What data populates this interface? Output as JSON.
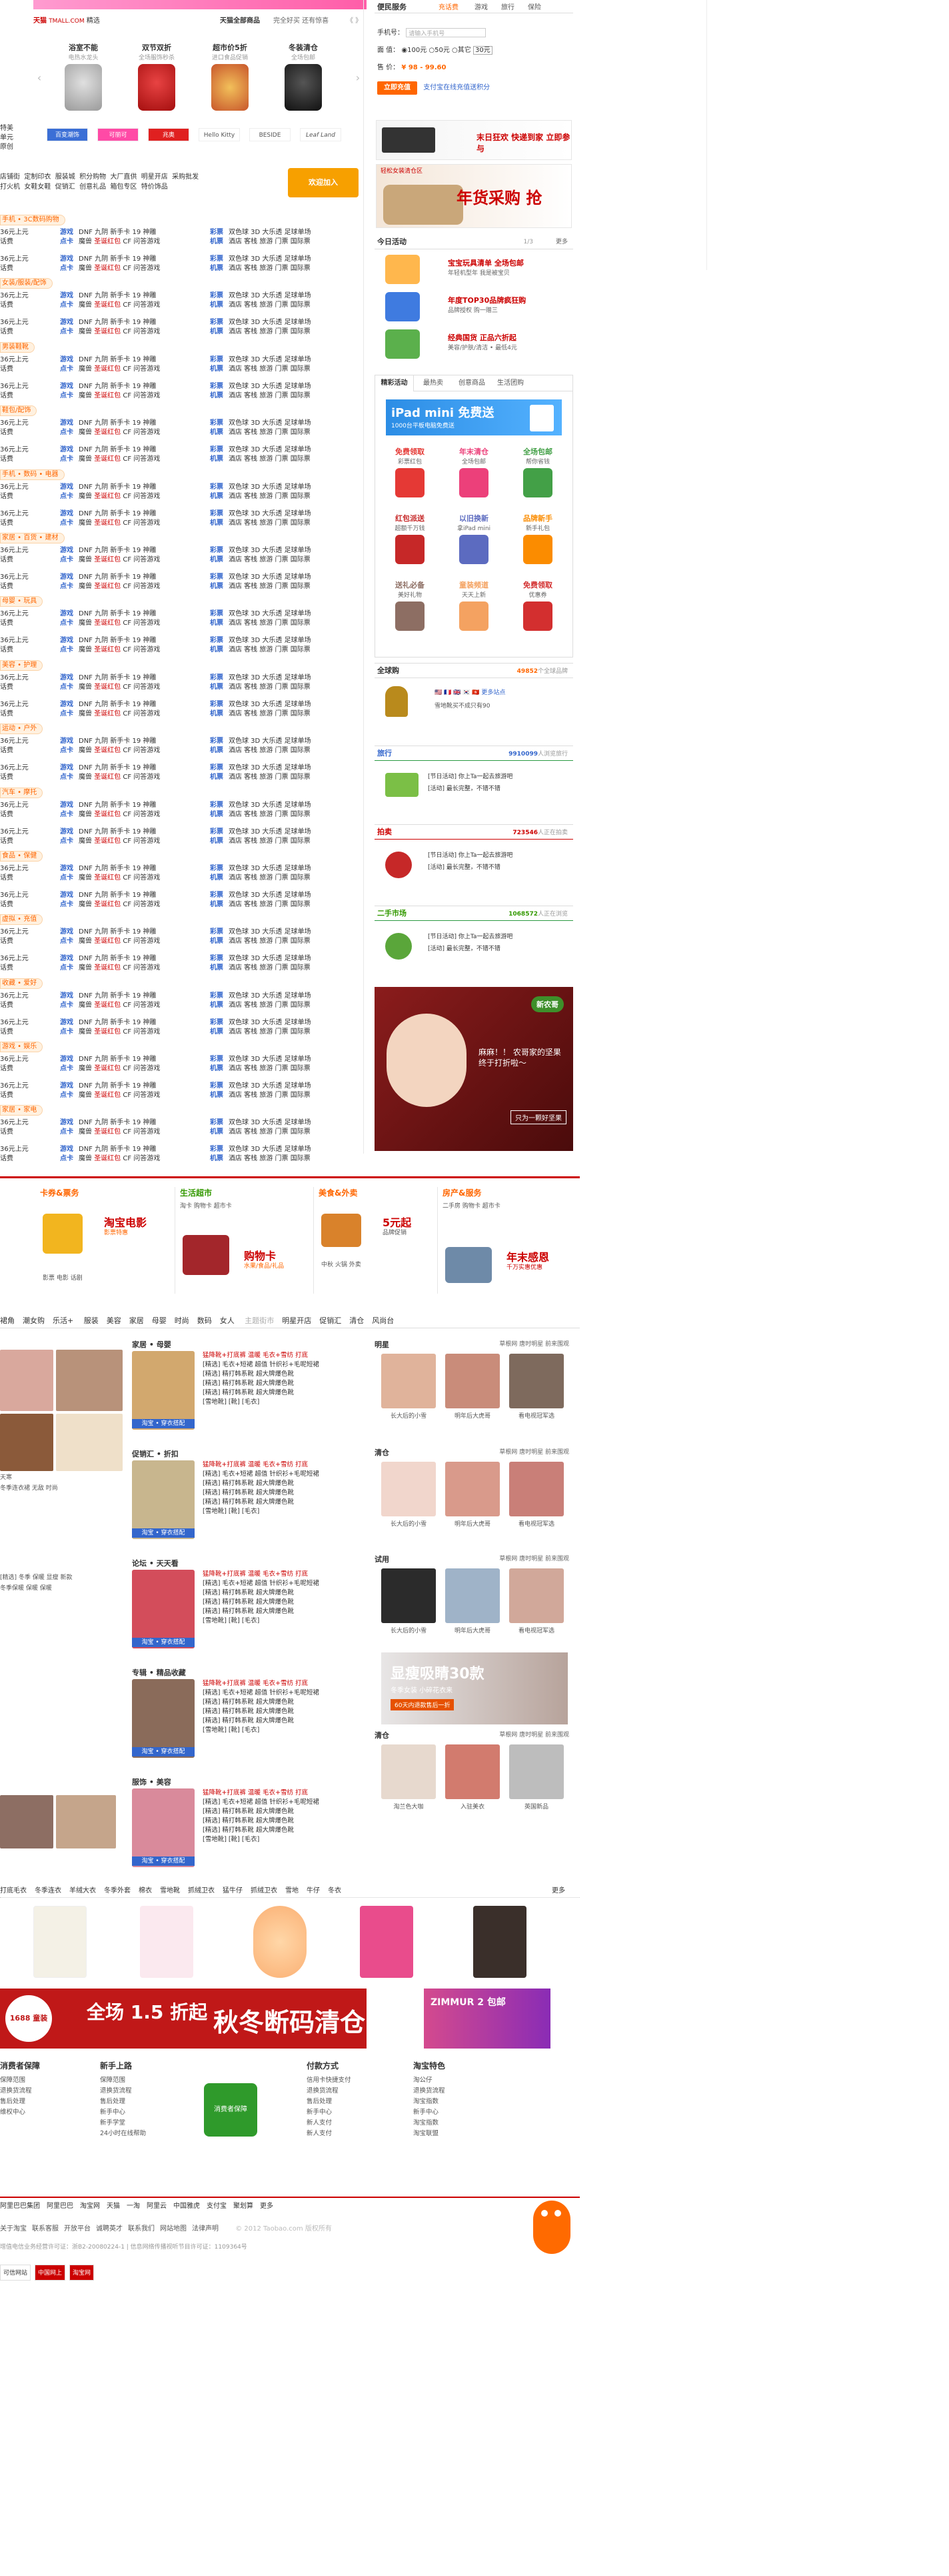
{
  "top": {
    "tmall_logo": "天猫",
    "tmall_url": "TMALL.COM",
    "tmall_tag": "精选",
    "tmall_link": "天猫全部商品",
    "tmall_note": "完全好买 还有惊喜",
    "nav_arrows": "《 》"
  },
  "brand_products": [
    {
      "title": "浴室不能",
      "sub": "电热水龙头"
    },
    {
      "title": "双节双折",
      "sub": "全场服饰秒杀"
    },
    {
      "title": "超市价5折",
      "sub": "进口食品促销"
    },
    {
      "title": "冬装清仓",
      "sub": "全场包邮"
    }
  ],
  "brand_logos": [
    "百变潮饰",
    "可丽可",
    "兆奥",
    "Hello Kitty",
    "BESIDE",
    "Leaf Land"
  ],
  "left_tip": [
    "特美",
    "单元",
    "原创"
  ],
  "quick_links": [
    [
      "店铺街",
      "定制印衣",
      "服装城",
      "积分购物",
      "大厂直供",
      "明星开店",
      "采购批发"
    ],
    [
      "打火机",
      "女鞋女鞋",
      "促销汇",
      "创意礼品",
      "箱包专区",
      "特价饰品"
    ]
  ],
  "quick_badge": "欢迎加入",
  "categories": [
    {
      "head": "手机 • 3C数码购物"
    },
    {
      "head": "女装/服装/配饰"
    },
    {
      "head": "男装鞋靴"
    },
    {
      "head": "鞋包/配饰"
    },
    {
      "head": "手机 • 数码 • 电器"
    },
    {
      "head": "家居 • 百货 • 建材"
    },
    {
      "head": "母婴 • 玩具"
    },
    {
      "head": "美容 • 护理"
    },
    {
      "head": "运动 • 户外"
    },
    {
      "head": "汽车 • 摩托"
    },
    {
      "head": "食品 • 保健"
    },
    {
      "head": "虚拟 • 充值"
    },
    {
      "head": "收藏 • 爱好"
    },
    {
      "head": "游戏 • 娱乐"
    },
    {
      "head": "家居 • 家电"
    }
  ],
  "category_lines": {
    "a_prefix": "36元上元",
    "b_prefix": "话费",
    "k1": "游戏",
    "k1_text": "DNF 九阴 新手卡 19 神雕",
    "k2": "点卡",
    "k2_text": "魔兽",
    "k2_red": "圣诞红包",
    "k2_tail": "CF 问答游戏",
    "k3": "彩票",
    "k3_text": "双色球 3D 大乐透 足球单场",
    "k4": "机票",
    "k4_text": "酒店 客栈 旅游 门票 国际票"
  },
  "right": {
    "service_title": "便民服务",
    "tabs": [
      "充话费",
      "游戏",
      "旅行",
      "保险"
    ],
    "phone_label": "手机号：",
    "phone_placeholder": "请输入手机号",
    "amount_label": "面  值：",
    "amount_options": [
      "100元",
      "50元",
      "其它",
      "30元"
    ],
    "price_label": "售  价：",
    "price_value": "¥ 98 - 99.60",
    "buy_button": "立即充值",
    "buy_note": "支付宝在线充值送积分",
    "ad1_text": "末日狂欢 快递到家 立即参与",
    "ad2_small": "轻松女装清仓区",
    "ad2_big": "年货采购 抢",
    "today_title": "今日活动",
    "today_pager": "1/3",
    "today_more": "更多",
    "today_items": [
      {
        "h": "宝宝玩具清单 全场包邮",
        "d": "年轻机型年 我是被宝贝"
      },
      {
        "h": "年度TOP30品牌疯狂购",
        "d": "品牌授权 购一赠三"
      },
      {
        "h": "经典国货 正品六折起",
        "d": "美容/护肤/清洁 • 最低4元"
      }
    ],
    "promo_tabs": [
      "精彩活动",
      "最热卖",
      "创意商品",
      "生活团购"
    ],
    "ipad_title": "iPad mini 免费送",
    "ipad_sub": "1000台平板电脑免费送",
    "promo_grid": [
      {
        "l1": "免费领取",
        "l2": "彩票红包"
      },
      {
        "l1": "年末清仓",
        "l2": "全场包邮"
      },
      {
        "l1": "全场包邮",
        "l2": "帮你省钱"
      },
      {
        "l1": "红包派送",
        "l2": "超额千万钱"
      },
      {
        "l1": "以旧换新",
        "l2": "拿iPad mini"
      },
      {
        "l1": "品牌新手",
        "l2": "新手礼包"
      },
      {
        "l1": "送礼必备",
        "l2": "美好礼物"
      },
      {
        "l1": "童装频道",
        "l2": "天天上新"
      },
      {
        "l1": "免费领取",
        "l2": "优惠券"
      }
    ],
    "global_title": "全球购",
    "global_count": "49852",
    "global_count_suffix": "个全球品牌",
    "global_more": "更多站点",
    "global_note": "雪地靴买不成只有90",
    "travel_title": "旅行",
    "travel_count": "9910099",
    "travel_suffix": "人浏览旅行",
    "travel_lines": [
      "[节日活动] 你上Ta一起去旅游吧",
      "[活动] 最长完整，不错不错"
    ],
    "auction_title": "拍卖",
    "auction_count": "723546",
    "auction_suffix": "人正在拍卖",
    "auction_lines": [
      "[节日活动] 你上Ta一起去旅游吧",
      "[活动] 最长完整，不错不错"
    ],
    "second_title": "二手市场",
    "second_count": "1068572",
    "second_suffix": "人正在浏览",
    "second_lines": [
      "[节日活动] 你上Ta一起去旅游吧",
      "[活动] 最长完整，不错不错"
    ],
    "baby_badge": "新农哥",
    "baby_text": "麻麻！！ 农哥家的坚果终于打折啦～",
    "baby_cta": "只为一颗好坚果"
  },
  "channels": [
    {
      "title": "卡券&票务",
      "big": "淘宝电影",
      "sub": "影票特惠",
      "lines": [
        "影票",
        "电影",
        "话剧"
      ]
    },
    {
      "title": "生活超市",
      "big": "购物卡",
      "sub": "水果/食品/礼品",
      "lines": [
        "淘卡",
        "购物卡",
        "超市卡"
      ]
    },
    {
      "title": "美食&外卖",
      "big": "5元起",
      "sub": "品牌促销",
      "lines": [
        "中秋",
        "火锅",
        "外卖"
      ]
    },
    {
      "title": "房产&服务",
      "big": "年末感恩",
      "sub": "千万实惠优惠",
      "lines": [
        "二手房",
        "购物卡",
        "超市卡"
      ]
    }
  ],
  "nav_bar": {
    "items": [
      "服装",
      "美容",
      "家居",
      "母婴",
      "时尚",
      "数码",
      "女人"
    ],
    "muted": "主题街市",
    "extra": [
      "明星开店",
      "促销汇",
      "清仓",
      "风尚台"
    ],
    "left": [
      "裙角",
      "潮女购",
      "乐活+"
    ]
  },
  "feed_sections": [
    {
      "h": "家居 • 母婴",
      "tag": "淘宝 • 穿衣搭配"
    },
    {
      "h": "促销汇 • 折扣",
      "tag": "淘宝 • 穿衣搭配"
    },
    {
      "h": "论坛 • 天天看",
      "tag": "淘宝 • 穿衣搭配"
    },
    {
      "h": "专辑 • 精品收藏",
      "tag": "淘宝 • 穿衣搭配"
    },
    {
      "h": "服饰 • 美容",
      "tag": "淘宝 • 穿衣搭配"
    }
  ],
  "feed_lines": {
    "l1": "猛降靴+打底裤 温暖 毛衣+雪纺 打底",
    "l2": "[精选] 毛衣+短裙 超值 针织衫+毛呢短裙",
    "l3": "[精选] 精打韩系靴 超大牌爆色靴",
    "l4": "[精选] 精打韩系靴 超大牌爆色靴",
    "l5": "[精选] 精打韩系靴 超大牌爆色靴",
    "l6": "[雪地靴] [靴] [毛衣]"
  },
  "left_texts": [
    "天寒",
    "冬季连衣裙 无敌 时尚",
    "[精选] 冬季 保暖 显瘦 新款",
    "冬季保暖 保暖 保暖"
  ],
  "stars": [
    {
      "h": "明星",
      "sub": "草根网 唐时明星 前来围观",
      "caps": [
        "长大后的小雪",
        "明年后大虎哥",
        "看电视冠军选"
      ]
    },
    {
      "h": "清仓",
      "sub": "草根网 唐时明星 前来围观",
      "caps": [
        "长大后的小雪",
        "明年后大虎哥",
        "看电视冠军选"
      ]
    },
    {
      "h": "试用",
      "sub": "草根网 唐时明星 前来围观",
      "caps": [
        "长大后的小雪",
        "明年后大虎哥",
        "看电视冠军选"
      ]
    },
    {
      "h": "清仓",
      "sub": "草根网 唐时明星 前来围观",
      "caps": [
        "淘兰色大咖",
        "入驻美衣",
        "英国新品"
      ]
    }
  ],
  "slim_ad": {
    "t": "显瘦吸睛30款",
    "s": "冬季女装 小碎花衣来",
    "s2": "60天内退款售后一折"
  },
  "cat_tags": [
    "打底毛衣",
    "冬季连衣",
    "羊绒大衣",
    "冬季外套",
    "棉衣",
    "雪地靴",
    "抓绒卫衣",
    "猛牛仔",
    "抓绒卫衣",
    "雪地",
    "牛仔",
    "冬衣"
  ],
  "cat_tags_more": "更多",
  "promo_banner": {
    "circle": "1688 童装",
    "t1": "全场 1.5 折起",
    "t2": "秋冬断码清仓"
  },
  "promo_side": {
    "t": "ZIMMUR 2 包邮"
  },
  "footer_cols": [
    {
      "h": "消费者保障",
      "items": [
        "保障范围",
        "退换货流程",
        "售后处理",
        "维权中心"
      ]
    },
    {
      "h": "新手上路",
      "items": [
        "保障范围",
        "退换货流程",
        "售后处理",
        "新手中心",
        "新手学堂",
        "24小时在线帮助"
      ]
    },
    {
      "h": "付款方式",
      "items": [
        "信用卡快捷支付",
        "退换货流程",
        "售后处理",
        "新手中心",
        "新人支付",
        "新人支付"
      ]
    },
    {
      "h": "淘宝特色",
      "items": [
        "淘公仔",
        "退换货流程",
        "淘宝指数",
        "新手中心",
        "淘宝指数",
        "淘宝联盟"
      ]
    }
  ],
  "green_badge": "消费者保障",
  "foot_nav": [
    "阿里巴巴集团",
    "阿里巴巴",
    "淘宝网",
    "天猫",
    "一淘",
    "阿里云",
    "中国雅虎",
    "支付宝",
    "聚划算",
    "更多"
  ],
  "foot_links": [
    "关于淘宝",
    "联系客服",
    "开放平台",
    "诚聘英才",
    "联系我们",
    "网站地图",
    "法律声明"
  ],
  "foot_copyright": "© 2012 Taobao.com 版权所有",
  "foot_icp": "增值电信业务经营许可证：浙B2-20080224-1 | 信息网络传播视听节目许可证：1109364号",
  "foot_badges": [
    "可信网站",
    "中国网上",
    "淘宝网"
  ]
}
